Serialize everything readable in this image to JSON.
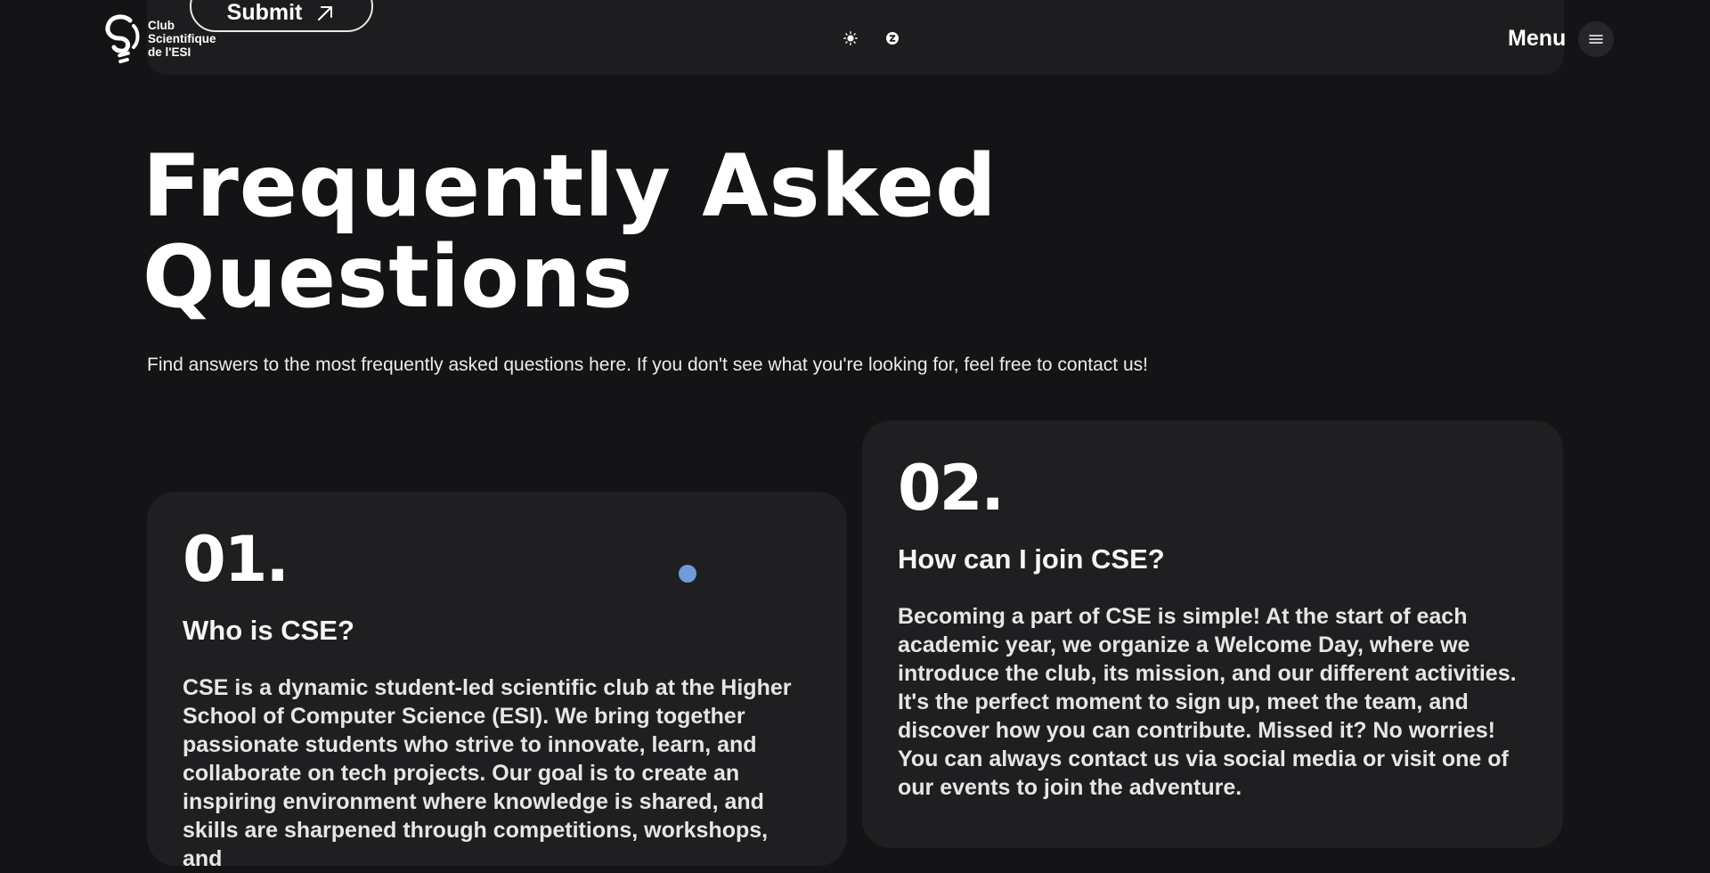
{
  "header": {
    "logo": {
      "lines": [
        "Club",
        "Scientifique",
        "de l'ESI"
      ]
    },
    "submit_label": "Submit",
    "menu_label": "Menu",
    "icons": {
      "submit": "arrow-up-right-icon",
      "light_theme": "sun-icon",
      "dark_theme": "moon-icon",
      "menu": "hamburger-icon"
    }
  },
  "hero": {
    "title_line_1": "Frequently Asked",
    "title_line_2": "Questions",
    "subtitle": "Find answers to the most frequently asked questions here. If you don't see what you're looking for, feel free to contact us!"
  },
  "faq": [
    {
      "number": "01.",
      "question": "Who is CSE?",
      "answer": "CSE is a dynamic student-led scientific club at the Higher School of Computer Science (ESI). We bring together passionate students who strive to innovate, learn, and collaborate on tech projects. Our goal is to create an inspiring environment where knowledge is shared, and skills are sharpened through competitions, workshops, and"
    },
    {
      "number": "02.",
      "question": "How can I join CSE?",
      "answer": "Becoming a part of CSE is simple! At the start of each academic year, we organize a Welcome Day, where we introduce the club, its mission, and our different activities. It's the perfect moment to sign up, meet the team, and discover how you can contribute. Missed it? No worries! You can always contact us via social media or visit one of our events to join the adventure."
    }
  ],
  "colors": {
    "background": "#141416",
    "panel": "#1d1d20",
    "card": "#1f1f22",
    "cursor": "#6f9bd8"
  }
}
